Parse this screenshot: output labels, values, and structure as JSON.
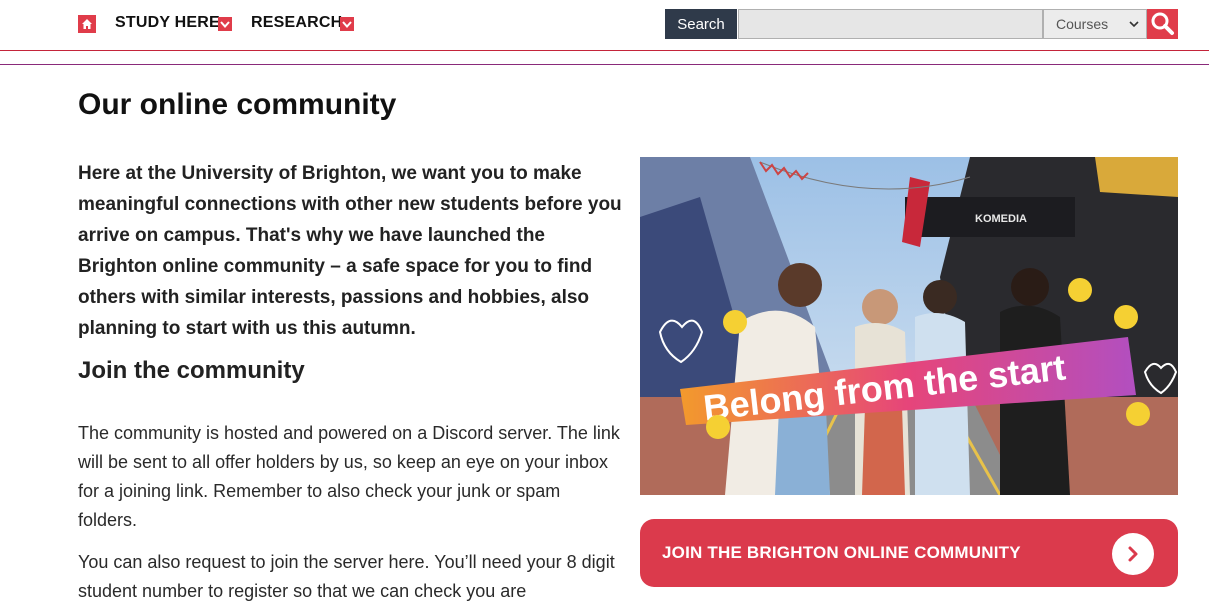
{
  "nav": {
    "items": [
      {
        "label": "STUDY HERE"
      },
      {
        "label": "RESEARCH"
      }
    ]
  },
  "search": {
    "label": "Search",
    "placeholder": "",
    "scope_selected": "Courses"
  },
  "main": {
    "title": "Our online community",
    "intro": "Here at the University of Brighton, we want you to make meaningful connections with other new students before you arrive on campus. That's why we have launched the Brighton online community – a safe space for you to find others with similar interests, passions and hobbies, also planning to start with us this autumn.",
    "section_heading": "Join the community",
    "paragraph_1": "The community is hosted and powered on a Discord server. The link will be sent to all offer holders by us, so keep an eye on your inbox for a joining link. Remember to also check your junk or spam folders.",
    "paragraph_2": "You can also request to join the server here. You’ll need your 8 digit student number to register so that we can check you are"
  },
  "hero": {
    "banner_text": "Belong from the start",
    "shop_sign": "KOMEDIA"
  },
  "cta": {
    "label": "JOIN THE BRIGHTON ONLINE COMMUNITY"
  },
  "colors": {
    "accent": "#db3a4c",
    "search_label_bg": "#2f3a4a"
  }
}
